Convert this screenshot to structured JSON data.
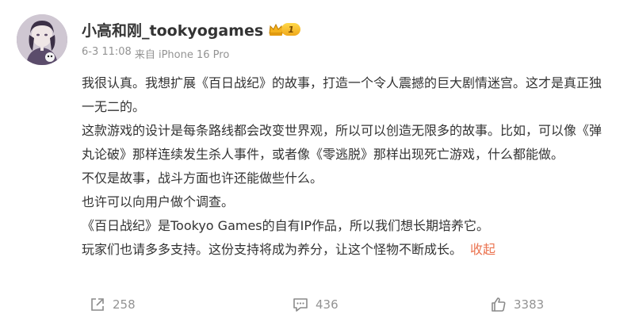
{
  "post": {
    "author": {
      "name": "小高和刚_tookyogames",
      "badge_level": "1"
    },
    "meta": {
      "time": "6-3 11:08",
      "source": "来自 iPhone 16 Pro"
    },
    "paragraphs": [
      "我很认真。我想扩展《百日战纪》的故事，打造一个令人震撼的巨大剧情迷宫。这才是真正独一无二的。",
      "这款游戏的设计是每条路线都会改变世界观，所以可以创造无限多的故事。比如，可以像《弹丸论破》那样连续发生杀人事件，或者像《零逃脱》那样出现死亡游戏，什么都能做。",
      "不仅是故事，战斗方面也许还能做些什么。",
      "也许可以向用户做个调查。",
      "《百日战纪》是Tookyo Games的自有IP作品，所以我们想长期培养它。",
      "玩家们也请多多支持。这份支持将成为养分，让这个怪物不断成长。"
    ],
    "collapse_label": "收起",
    "actions": {
      "share_count": "258",
      "comment_count": "436",
      "like_count": "3383"
    }
  }
}
